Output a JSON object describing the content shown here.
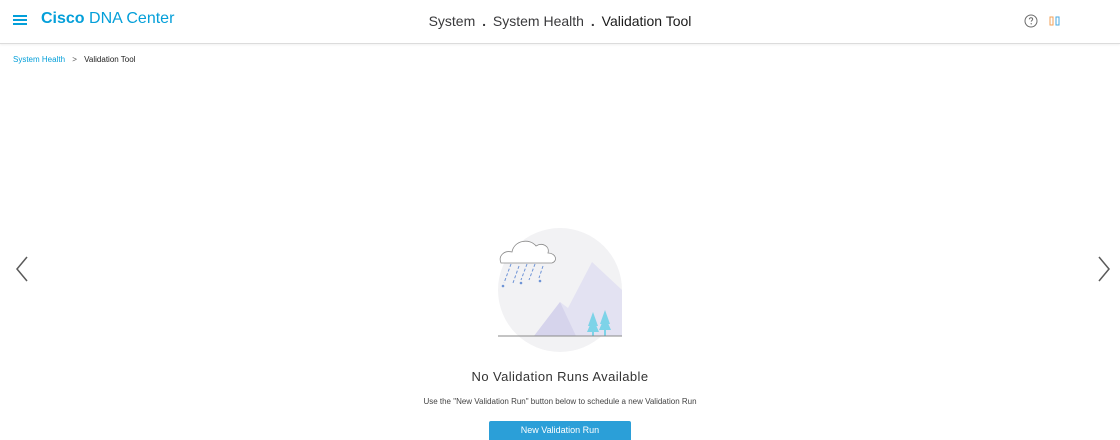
{
  "header": {
    "brand_bold": "Cisco",
    "brand_rest": "DNA Center",
    "title": {
      "part1": "System",
      "sep1": ".",
      "part2": "System Health",
      "sep2": ".",
      "part3": "Validation Tool"
    },
    "icons": [
      "menu-icon",
      "help-icon",
      "apps-icon"
    ]
  },
  "breadcrumb": {
    "parent": "System Health",
    "separator": ">",
    "current": "Validation Tool"
  },
  "empty_state": {
    "title": "No Validation Runs Available",
    "subtitle": "Use the \"New Validation Run\" button below to schedule a new Validation Run",
    "button_label": "New Validation Run",
    "illustration": "rain-cloud-mountain-illustration"
  },
  "carousel": {
    "prev_icon": "chevron-left-icon",
    "next_icon": "chevron-right-icon"
  },
  "colors": {
    "brand": "#049fd9",
    "primary_button": "#2b9fd8",
    "illustration_circle": "#f2f2f4",
    "mountain": "#dcdbee",
    "tree": "#7dd3e8",
    "rain": "#6f94d6"
  }
}
